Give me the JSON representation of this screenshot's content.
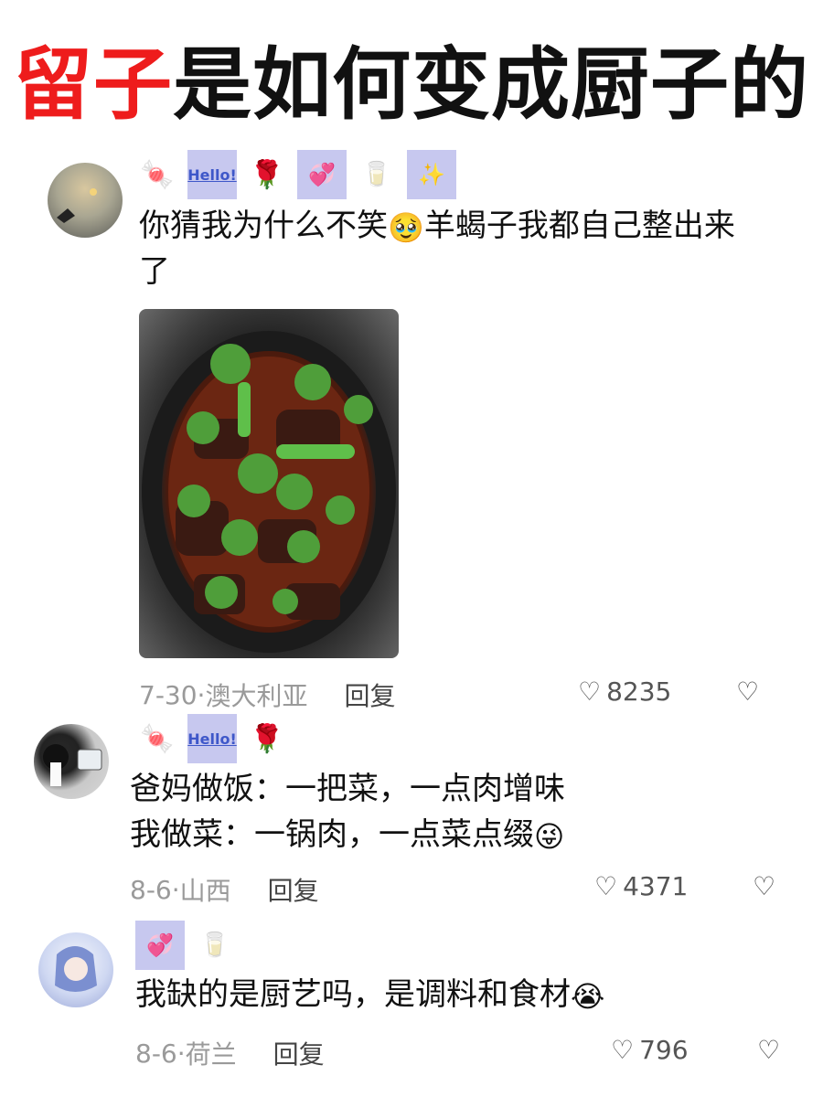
{
  "title": {
    "red_part": "留子",
    "black_part": "是如何变成厨子的"
  },
  "comments": [
    {
      "stickers": [
        "candy",
        "Hello!",
        "rose",
        "hearts",
        "milk",
        "sparkle-hearts"
      ],
      "text_lines": [
        "你猜我为什么不笑",
        "羊蝎子我都自己整出来",
        "了"
      ],
      "inline_emoji": "🥹",
      "date": "7-30",
      "location": "澳大利亚",
      "reply": "回复",
      "likes": "8235"
    },
    {
      "stickers": [
        "candy",
        "Hello!",
        "rose"
      ],
      "text_lines": [
        "爸妈做饭：一把菜，一点肉增味",
        "我做菜：一锅肉，一点菜点缀"
      ],
      "inline_emoji": "😜",
      "date": "8-6",
      "location": "山西",
      "reply": "回复",
      "likes": "4371"
    },
    {
      "stickers": [
        "hearts",
        "milk"
      ],
      "text_lines": [
        "我缺的是厨艺吗，是调料和食材"
      ],
      "inline_emoji": "😭",
      "date": "8-6",
      "location": "荷兰",
      "reply": "回复",
      "likes": "796"
    }
  ],
  "icons": {
    "heart": "♡",
    "broken_heart": "💔",
    "candy": "🍬",
    "rose": "🌹",
    "hearts": "💞",
    "milk": "🥛"
  }
}
